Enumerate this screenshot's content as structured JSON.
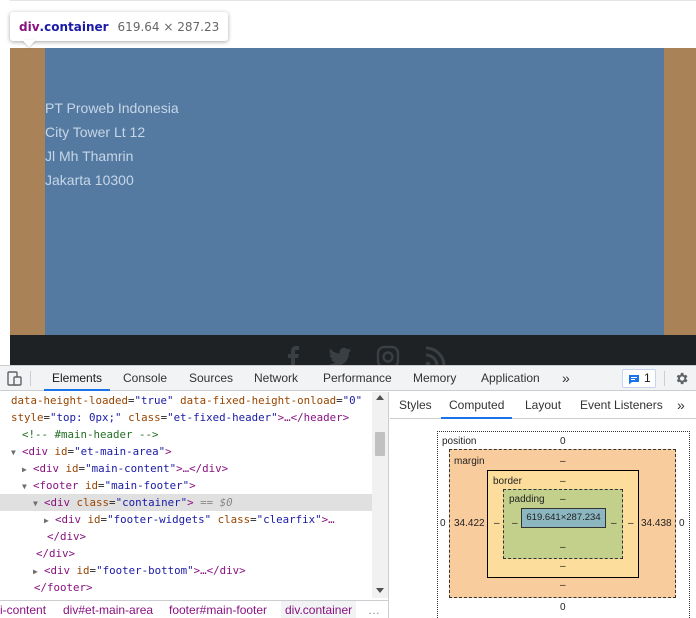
{
  "tooltip": {
    "tag": "div",
    "class": ".container",
    "size": "619.64 × 287.23"
  },
  "page": {
    "address": [
      "PT Proweb Indonesia",
      "City Tower Lt 12",
      "Jl Mh Thamrin",
      "Jakarta 10300"
    ],
    "social_icons": [
      "facebook-icon",
      "twitter-icon",
      "instagram-icon",
      "rss-icon"
    ],
    "colors": {
      "container": "#557aa1",
      "band": "#a98258",
      "footer_bottom": "#1f2224"
    }
  },
  "devtools": {
    "tabs": [
      "Elements",
      "Console",
      "Sources",
      "Network",
      "Performance",
      "Memory",
      "Application"
    ],
    "active_tab": "Elements",
    "more_tabs": "»",
    "issues_count": "1",
    "code_lines": [
      {
        "a": "data-height-loaded",
        "v": "\"true\"",
        "a2": "data-fixed-height-onload",
        "v2": "\"0\""
      },
      {
        "a": "style",
        "v": "\"top: 0px;\"",
        "a2": "class",
        "v2": "\"et-fixed-header\"",
        "tail": ">…</header>"
      },
      {
        "comment": "<!-- #main-header -->"
      },
      {
        "tag": "<div",
        "a": "id",
        "v": "\"et-main-area\"",
        "close": ">"
      },
      {
        "tag": "<div",
        "a": "id",
        "v": "\"main-content\"",
        "close": ">…</div>"
      },
      {
        "tag": "<footer",
        "a": "id",
        "v": "\"main-footer\"",
        "close": ">"
      },
      {
        "tag": "<div",
        "a": "class",
        "v": "\"container\"",
        "close": ">",
        "marker": "== $0"
      },
      {
        "tag": "<div",
        "a": "id",
        "v": "\"footer-widgets\"",
        "a2": "class",
        "v2": "\"clearfix\"",
        "close": ">…"
      },
      {
        "tag": "</div>"
      },
      {
        "tag": "</div>"
      },
      {
        "tag": "<div",
        "a": "id",
        "v": "\"footer-bottom\"",
        "close": ">…</div>"
      },
      {
        "tag": "</footer>"
      }
    ],
    "breadcrumbs": [
      "i-content",
      "div#et-main-area",
      "footer#main-footer",
      "div.container",
      "…"
    ],
    "side_tabs": [
      "Styles",
      "Computed",
      "Layout",
      "Event Listeners"
    ],
    "side_active": "Computed",
    "side_more": "»",
    "box_model": {
      "position_label": "position",
      "position_top": "0",
      "position_left": "0",
      "position_right": "0",
      "position_bottom": "0",
      "margin_label": "margin",
      "margin_top": "–",
      "margin_left": "34.422",
      "margin_right": "34.438",
      "margin_bottom": "–",
      "border_label": "border",
      "border_top": "–",
      "border_left": "–",
      "border_right": "–",
      "border_bottom": "–",
      "padding_label": "padding",
      "padding_top": "–",
      "padding_left": "–",
      "padding_right": "–",
      "padding_bottom": "–",
      "content": "619.641×287.234"
    }
  }
}
